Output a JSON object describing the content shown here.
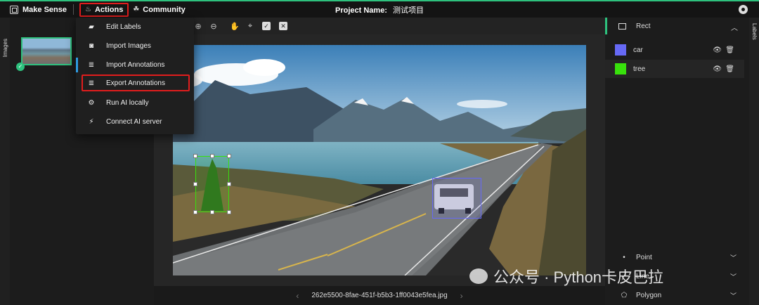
{
  "app": {
    "title": "Make Sense",
    "project_label": "Project Name:",
    "project_name": "测试项目"
  },
  "nav": {
    "actions": "Actions",
    "community": "Community"
  },
  "tabs": {
    "images": "Images",
    "labels": "Labels"
  },
  "dropdown": {
    "items": [
      {
        "label": "Edit Labels",
        "icon": "tag-icon"
      },
      {
        "label": "Import Images",
        "icon": "camera-icon"
      },
      {
        "label": "Import Annotations",
        "icon": "import-icon"
      },
      {
        "label": "Export Annotations",
        "icon": "export-icon"
      },
      {
        "label": "Run AI locally",
        "icon": "ai-icon"
      },
      {
        "label": "Connect AI server",
        "icon": "plug-icon"
      }
    ]
  },
  "editor": {
    "filename": "262e5500-8fae-451f-b5b3-1ff0043e5fea.jpg"
  },
  "labels_panel": {
    "rect_title": "Rect",
    "labels": [
      {
        "name": "car",
        "color": "#6669f5"
      },
      {
        "name": "tree",
        "color": "#38e10c"
      }
    ],
    "sections": [
      "Point",
      "Line",
      "Polygon"
    ]
  },
  "watermark": "公众号 · Python卡皮巴拉",
  "colors": {
    "accent": "#2ec27e",
    "highlight": "#e11d1d"
  }
}
